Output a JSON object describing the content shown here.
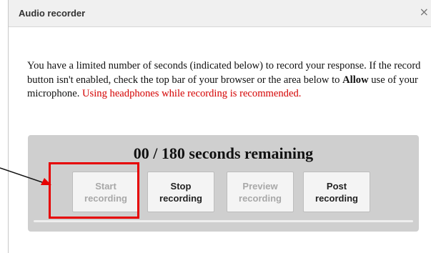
{
  "dialog": {
    "title": "Audio recorder",
    "close_icon": "×"
  },
  "instructions": {
    "part1": "You have a limited number of seconds (indicated below) to record your response. If the record button isn't enabled, check the top bar of your browser or the area below to ",
    "bold": "Allow",
    "part2": " use of your microphone. ",
    "warning": "Using headphones while recording is recommended."
  },
  "recorder": {
    "timer_text": "00 / 180 seconds remaining",
    "progress": 0,
    "buttons": {
      "start": {
        "line1": "Start",
        "line2": "recording",
        "enabled": false
      },
      "stop": {
        "line1": "Stop",
        "line2": "recording",
        "enabled": true
      },
      "preview": {
        "line1": "Preview",
        "line2": "recording",
        "enabled": false
      },
      "post": {
        "line1": "Post",
        "line2": "recording",
        "enabled": true
      }
    }
  },
  "annotation": {
    "highlight_color": "#e60000",
    "arrow_icon": "arrow-right-icon"
  },
  "colors": {
    "warning_text": "#d40000",
    "panel_bg": "#cfcfcf"
  }
}
